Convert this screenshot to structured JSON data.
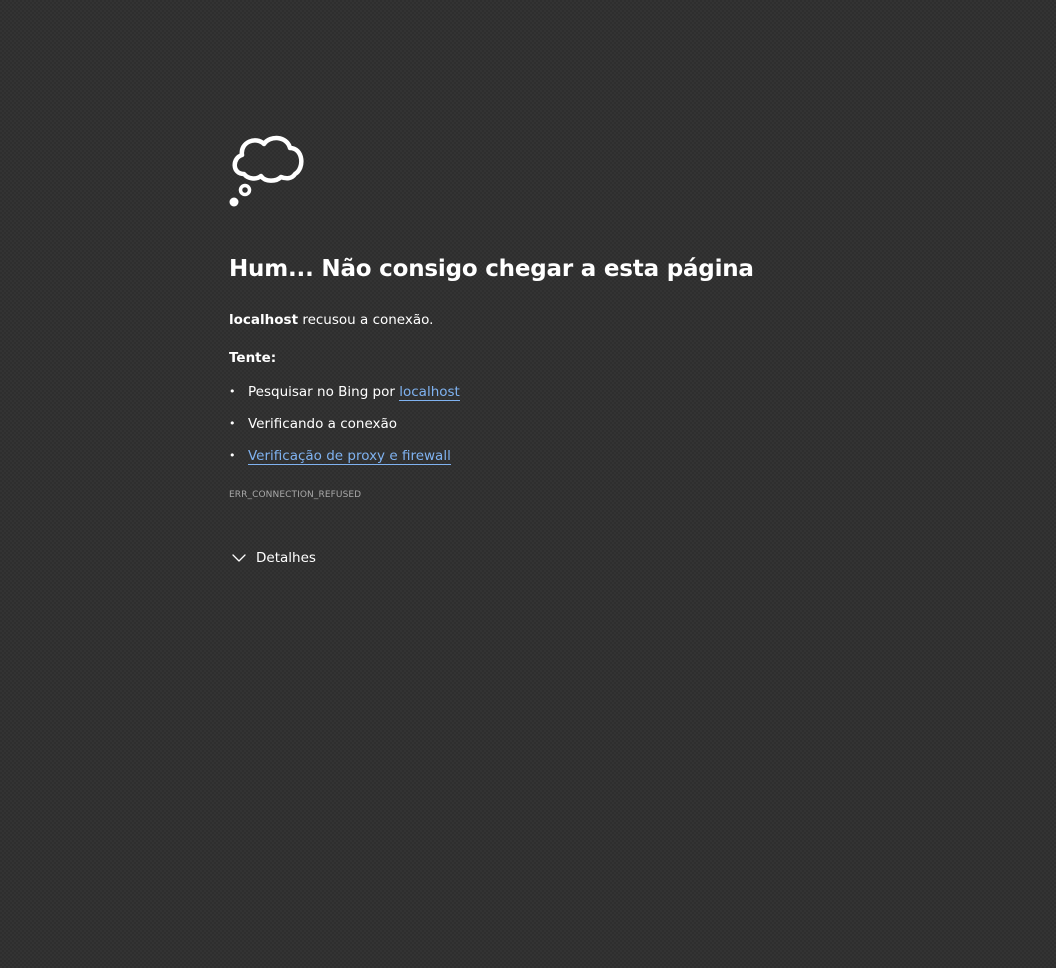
{
  "error_page": {
    "icon": "thought-cloud-icon",
    "title": "Hum... Não consigo chegar a esta página",
    "host": "localhost",
    "message_rest": " recusou a conexão.",
    "try_heading": "Tente:",
    "suggestions": [
      {
        "prefix": "Pesquisar no Bing por ",
        "link": "localhost"
      },
      {
        "prefix": "Verificando a conexão",
        "link": ""
      },
      {
        "prefix": "",
        "link": "Verificação de proxy e firewall"
      }
    ],
    "error_code": "ERR_CONNECTION_REFUSED",
    "details_label": "Detalhes",
    "details_icon": "chevron-down-icon"
  },
  "colors": {
    "background": "#2e2e2e",
    "text": "#ffffff",
    "link": "#7fb2f0",
    "error_code": "#a8a8a8"
  }
}
